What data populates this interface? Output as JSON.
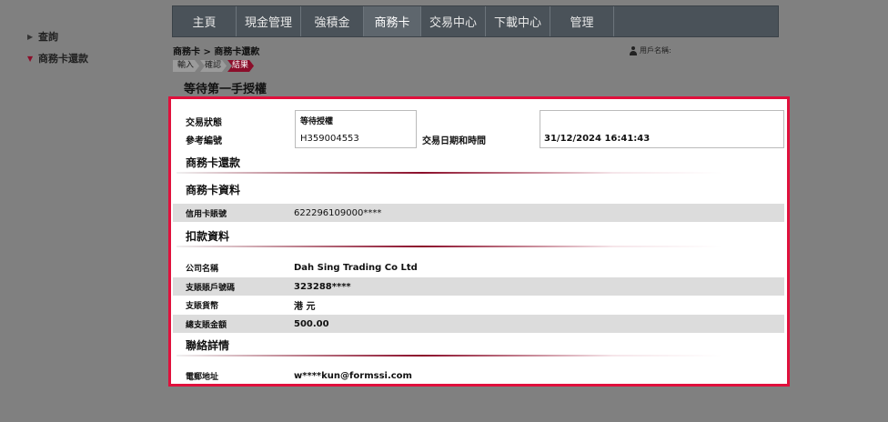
{
  "sidebar": {
    "items": [
      {
        "label": "查詢",
        "expanded": false
      },
      {
        "label": "商務卡還款",
        "expanded": true
      }
    ]
  },
  "nav": {
    "tabs": [
      {
        "label": "主頁",
        "active": false
      },
      {
        "label": "現金管理",
        "active": false
      },
      {
        "label": "強積金",
        "active": false
      },
      {
        "label": "商務卡",
        "active": true
      },
      {
        "label": "交易中心",
        "active": false
      },
      {
        "label": "下載中心",
        "active": false
      },
      {
        "label": "管理",
        "active": false
      }
    ]
  },
  "breadcrumb": "商務卡 > 商務卡還款",
  "user_label": "用戶名稱:",
  "steps": [
    {
      "label": "輸入",
      "current": false
    },
    {
      "label": "確認",
      "current": false
    },
    {
      "label": "結果",
      "current": true
    }
  ],
  "page_title": "等待第一手授權",
  "status": {
    "state_label": "交易狀態",
    "state_value": "等待授權",
    "ref_label": "參考編號",
    "ref_value": "H359004553",
    "datetime_label": "交易日期和時間",
    "datetime_value": "31/12/2024 16:41:43"
  },
  "sections": {
    "repayment": "商務卡還款",
    "card_info": "商務卡資料",
    "debit_info": "扣款資料",
    "contact": "聯絡詳情"
  },
  "card": {
    "card_no_label": "信用卡賬號",
    "card_no_value": "622296109000****"
  },
  "debit": {
    "company_label": "公司名稱",
    "company_value": "Dah Sing Trading Co Ltd",
    "account_label": "支賬賬戶號碼",
    "account_value": "323288****",
    "currency_label": "支賬貨幣",
    "currency_value": "港 元",
    "amount_label": "總支賬金額",
    "amount_value": "500.00"
  },
  "contact": {
    "email_label": "電郵地址",
    "email_value": "w****kun@formssi.com"
  },
  "colors": {
    "highlight_border": "#e0103c",
    "accent": "#8b0e2a",
    "nav_bg": "#4a5259"
  }
}
